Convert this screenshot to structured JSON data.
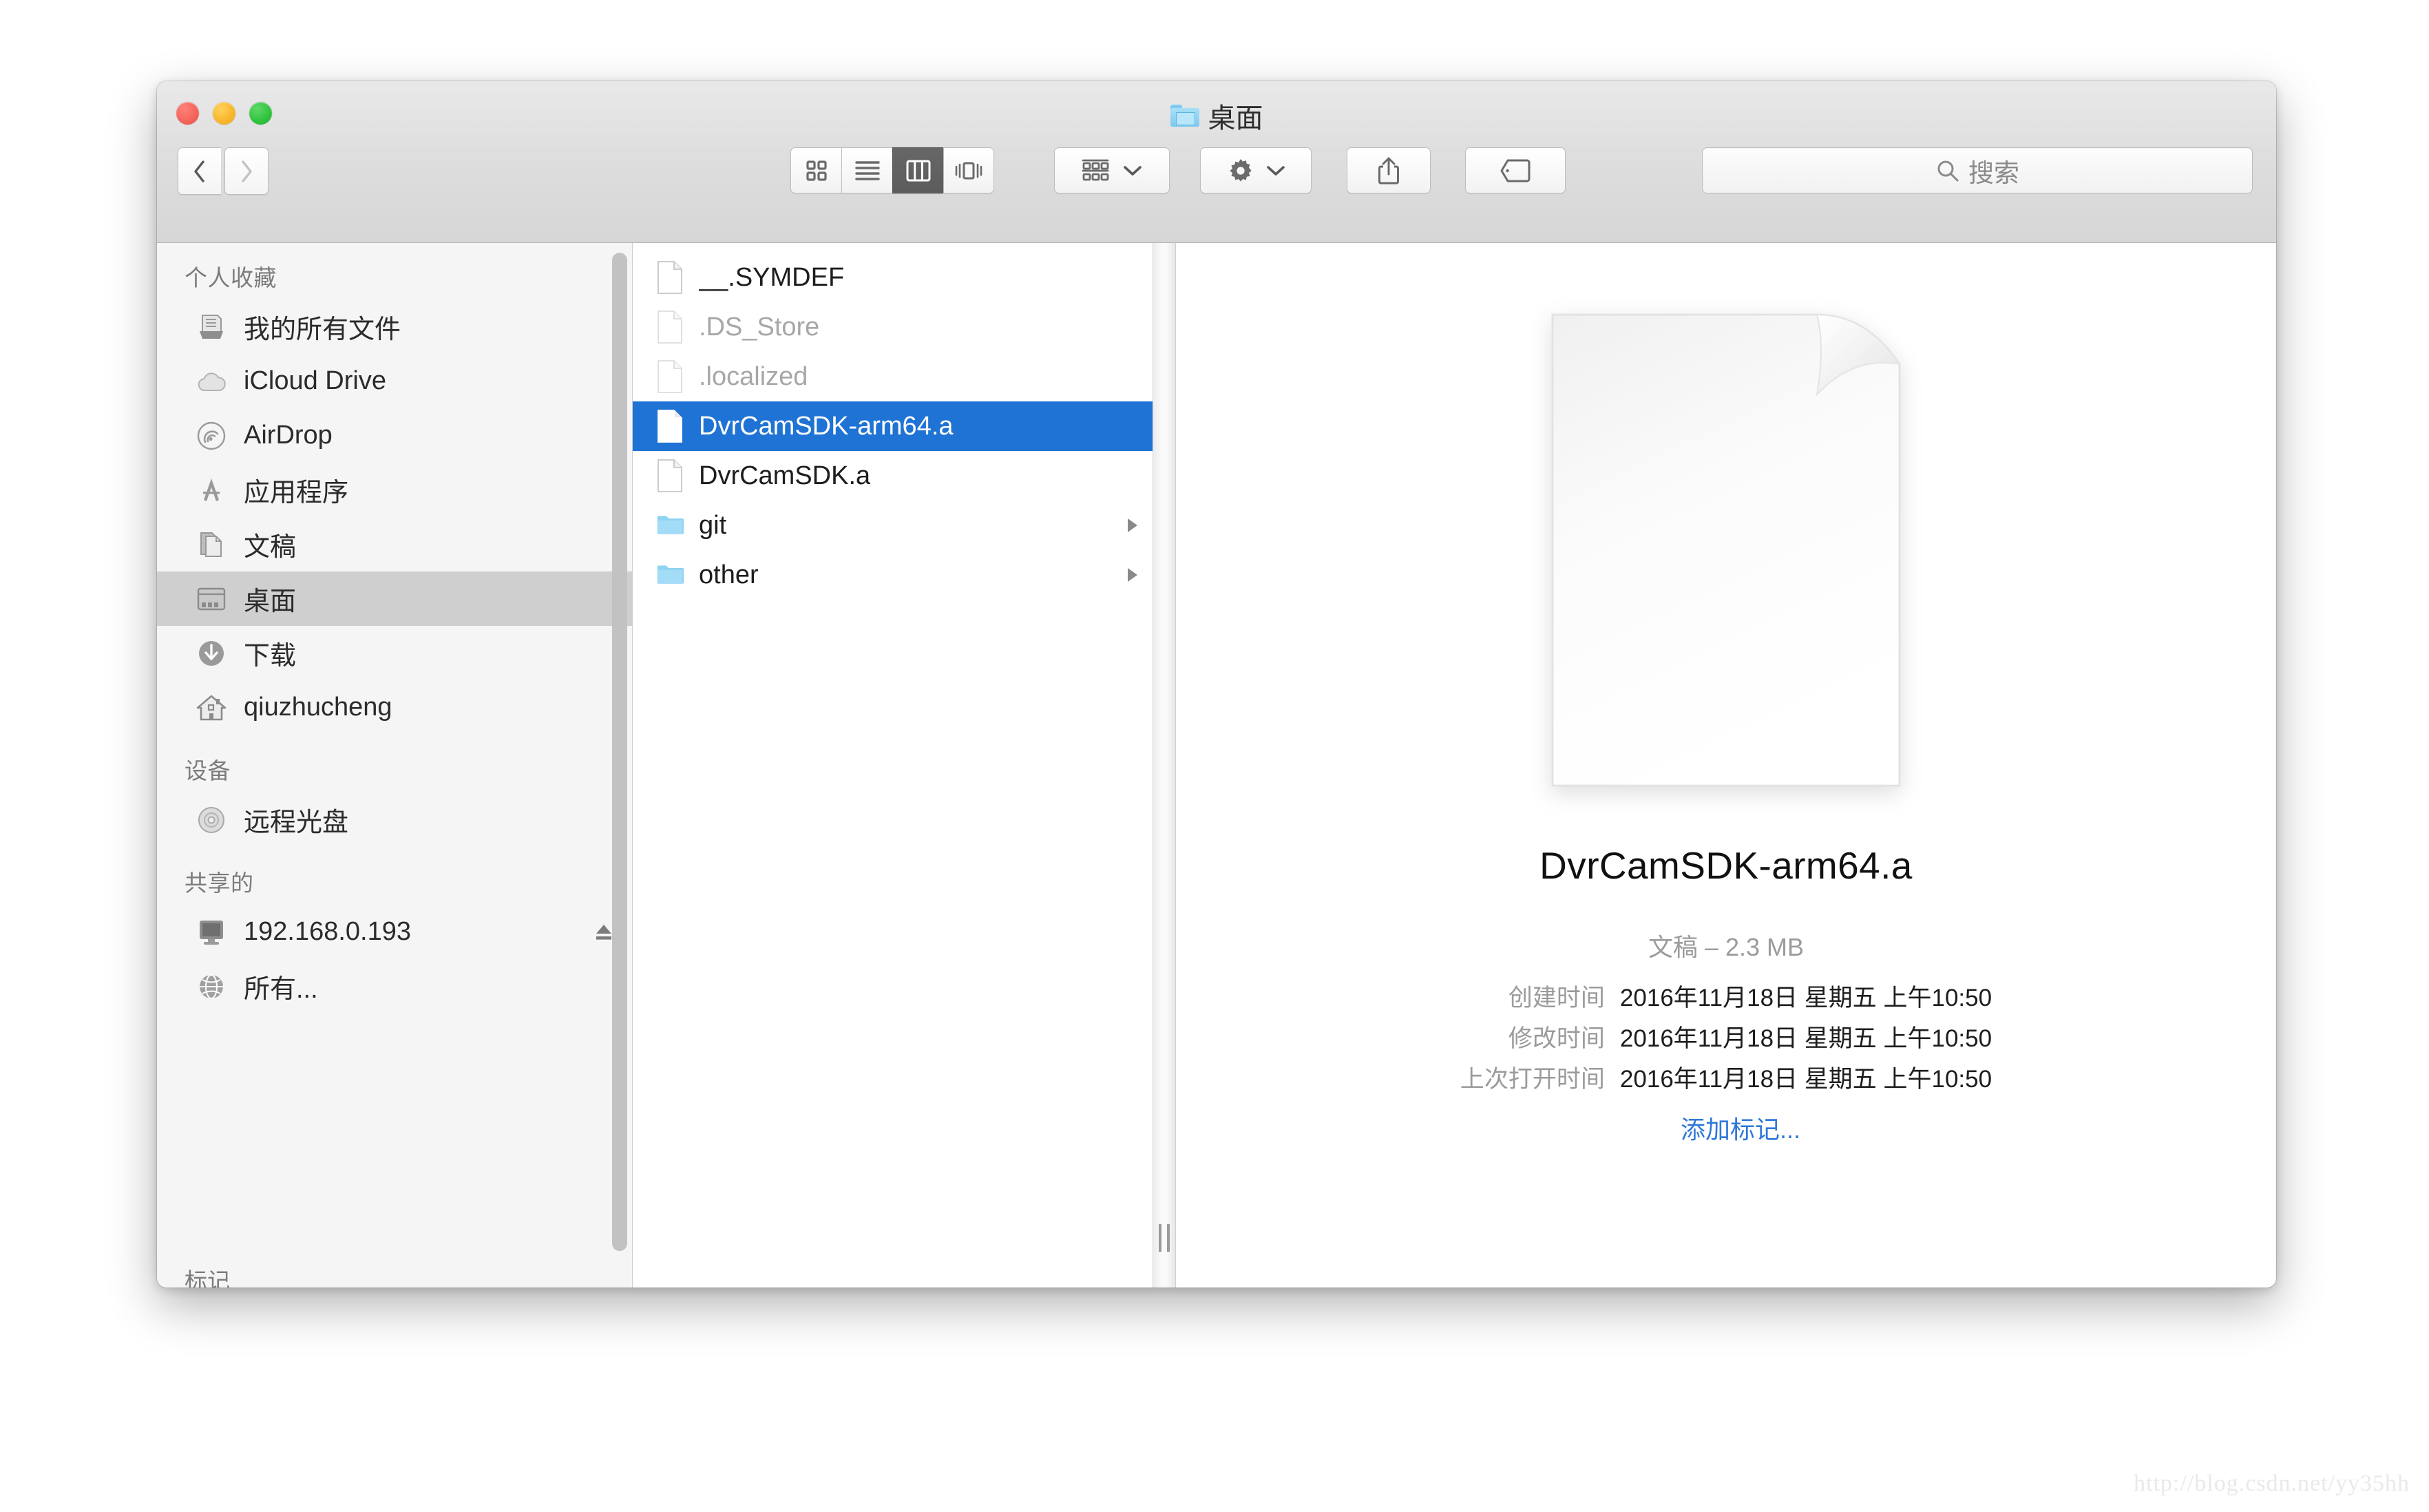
{
  "window": {
    "title": "桌面",
    "title_icon": "folder-icon",
    "traffic_lights": [
      {
        "name": "close-button",
        "color": "#f4635a"
      },
      {
        "name": "minimize-button",
        "color": "#f9b52b"
      },
      {
        "name": "zoom-button",
        "color": "#2fc23c"
      }
    ]
  },
  "toolbar": {
    "back_label": "back-chevron-icon",
    "forward_label": "forward-chevron-icon",
    "view_modes": [
      {
        "name": "icon-view",
        "icon": "grid-four-squares-icon",
        "selected": false
      },
      {
        "name": "list-view",
        "icon": "horizontal-lines-icon",
        "selected": false
      },
      {
        "name": "column-view",
        "icon": "three-columns-icon",
        "selected": true
      },
      {
        "name": "coverflow-view",
        "icon": "coverflow-icon",
        "selected": false
      }
    ],
    "arrange": {
      "icon": "arrange-grid-icon",
      "chevron": "chevron-down-icon"
    },
    "action": {
      "icon": "gear-icon",
      "chevron": "chevron-down-icon"
    },
    "share": {
      "icon": "share-upload-icon"
    },
    "tags": {
      "icon": "tag-label-icon"
    }
  },
  "search": {
    "icon": "search-icon",
    "placeholder": "搜索",
    "value": ""
  },
  "sidebar": {
    "sections": [
      {
        "header": "个人收藏",
        "items": [
          {
            "label": "我的所有文件",
            "icon": "all-my-files-icon",
            "selected": false
          },
          {
            "label": "iCloud Drive",
            "icon": "icloud-icon",
            "selected": false
          },
          {
            "label": "AirDrop",
            "icon": "airdrop-icon",
            "selected": false
          },
          {
            "label": "应用程序",
            "icon": "applications-icon",
            "selected": false
          },
          {
            "label": "文稿",
            "icon": "documents-icon",
            "selected": false
          },
          {
            "label": "桌面",
            "icon": "desktop-icon",
            "selected": true
          },
          {
            "label": "下载",
            "icon": "downloads-icon",
            "selected": false
          },
          {
            "label": "qiuzhucheng",
            "icon": "home-icon",
            "selected": false
          }
        ]
      },
      {
        "header": "设备",
        "items": [
          {
            "label": "远程光盘",
            "icon": "remote-disc-icon",
            "selected": false
          }
        ]
      },
      {
        "header": "共享的",
        "items": [
          {
            "label": "192.168.0.193",
            "icon": "computer-display-icon",
            "selected": false,
            "eject": true
          },
          {
            "label": "所有...",
            "icon": "network-globe-icon",
            "selected": false
          }
        ]
      }
    ],
    "cut_off_header": "标记"
  },
  "file_list": [
    {
      "name": "__.SYMDEF",
      "type": "file",
      "icon": "document-icon",
      "state": "normal",
      "selected": false,
      "expandable": false
    },
    {
      "name": ".DS_Store",
      "type": "file",
      "icon": "document-icon",
      "state": "hidden",
      "selected": false,
      "expandable": false
    },
    {
      "name": ".localized",
      "type": "file",
      "icon": "document-icon",
      "state": "hidden",
      "selected": false,
      "expandable": false
    },
    {
      "name": "DvrCamSDK-arm64.a",
      "type": "file",
      "icon": "document-icon",
      "state": "normal",
      "selected": true,
      "expandable": false
    },
    {
      "name": "DvrCamSDK.a",
      "type": "file",
      "icon": "document-icon",
      "state": "normal",
      "selected": false,
      "expandable": false
    },
    {
      "name": "git",
      "type": "folder",
      "icon": "folder-icon",
      "state": "normal",
      "selected": false,
      "expandable": true
    },
    {
      "name": "other",
      "type": "folder",
      "icon": "folder-icon",
      "state": "normal",
      "selected": false,
      "expandable": true
    }
  ],
  "preview": {
    "icon": "blank-document-icon",
    "name": "DvrCamSDK-arm64.a",
    "kind_and_size": "文稿 – 2.3 MB",
    "metadata": [
      {
        "label": "创建时间",
        "value": "2016年11月18日 星期五 上午10:50"
      },
      {
        "label": "修改时间",
        "value": "2016年11月18日 星期五 上午10:50"
      },
      {
        "label": "上次打开时间",
        "value": "2016年11月18日 星期五 上午10:50"
      }
    ],
    "add_tags_label": "添加标记...",
    "add_tags_color": "#2f78d8"
  },
  "colors": {
    "selection_blue": "#1f73d4",
    "sidebar_selection": "#cfcfcf",
    "link_blue": "#2f78d8",
    "folder_blue": "#7ecbf0"
  },
  "watermark": "http://blog.csdn.net/yy35hh"
}
